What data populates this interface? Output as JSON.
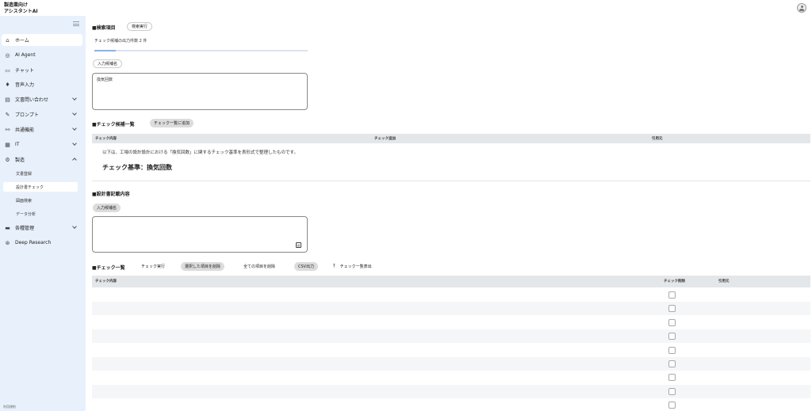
{
  "app": {
    "title_line1": "製造業向け",
    "title_line2": "アシスタントAI"
  },
  "sidebar": {
    "items": [
      {
        "label": "ホーム",
        "icon": "home-icon"
      },
      {
        "label": "AI Agent",
        "icon": "headset-icon"
      },
      {
        "label": "チャット",
        "icon": "chat-icon"
      },
      {
        "label": "音声入力",
        "icon": "microphone-icon"
      },
      {
        "label": "文書問い合わせ",
        "icon": "document-icon"
      },
      {
        "label": "プロンプト",
        "icon": "pen-icon"
      },
      {
        "label": "共通機能",
        "icon": "share-icon"
      },
      {
        "label": "IT",
        "icon": "server-icon"
      },
      {
        "label": "製造",
        "icon": "gear-box-icon"
      },
      {
        "label": "各種管理",
        "icon": "folder-icon"
      },
      {
        "label": "Deep Research",
        "icon": "research-icon"
      }
    ],
    "sub_items": [
      "文書登録",
      "設計書チェック",
      "図面検索",
      "データ分析"
    ],
    "footer": "利用規約"
  },
  "search": {
    "title": "■検索項目",
    "run_button": "検索実行",
    "count_text": "チェック候補の出力件数 2 件",
    "progress_fraction": 0.1,
    "input_label": "入力候補名",
    "input_value": "換気回数"
  },
  "candidates": {
    "title": "■チェック候補一覧",
    "add_button": "チェック一覧に追加",
    "columns": [
      "チェック内容",
      "チェック追加",
      "引用元"
    ],
    "description": "以下は、工場の設計設計における「換気回数」に関するチェック基準を表形式で整理したものです。",
    "criteria": "チェック基準：換気回数"
  },
  "design": {
    "title": "■設計書記載内容",
    "input_label": "入力候補名",
    "pdf_icon": "pdf-icon"
  },
  "checklist": {
    "title": "■チェック一覧",
    "buttons": [
      "チェック実行",
      "選択した項目を削除",
      "全ての項目を削除",
      "CSV出力",
      "チェック一覧表出"
    ],
    "columns": [
      "チェック内容",
      "チェック削除",
      "引用元"
    ],
    "row_count": 9
  },
  "colors": {
    "sidebar_bg": "#e8f1fb",
    "accent": "#8fb3db"
  }
}
